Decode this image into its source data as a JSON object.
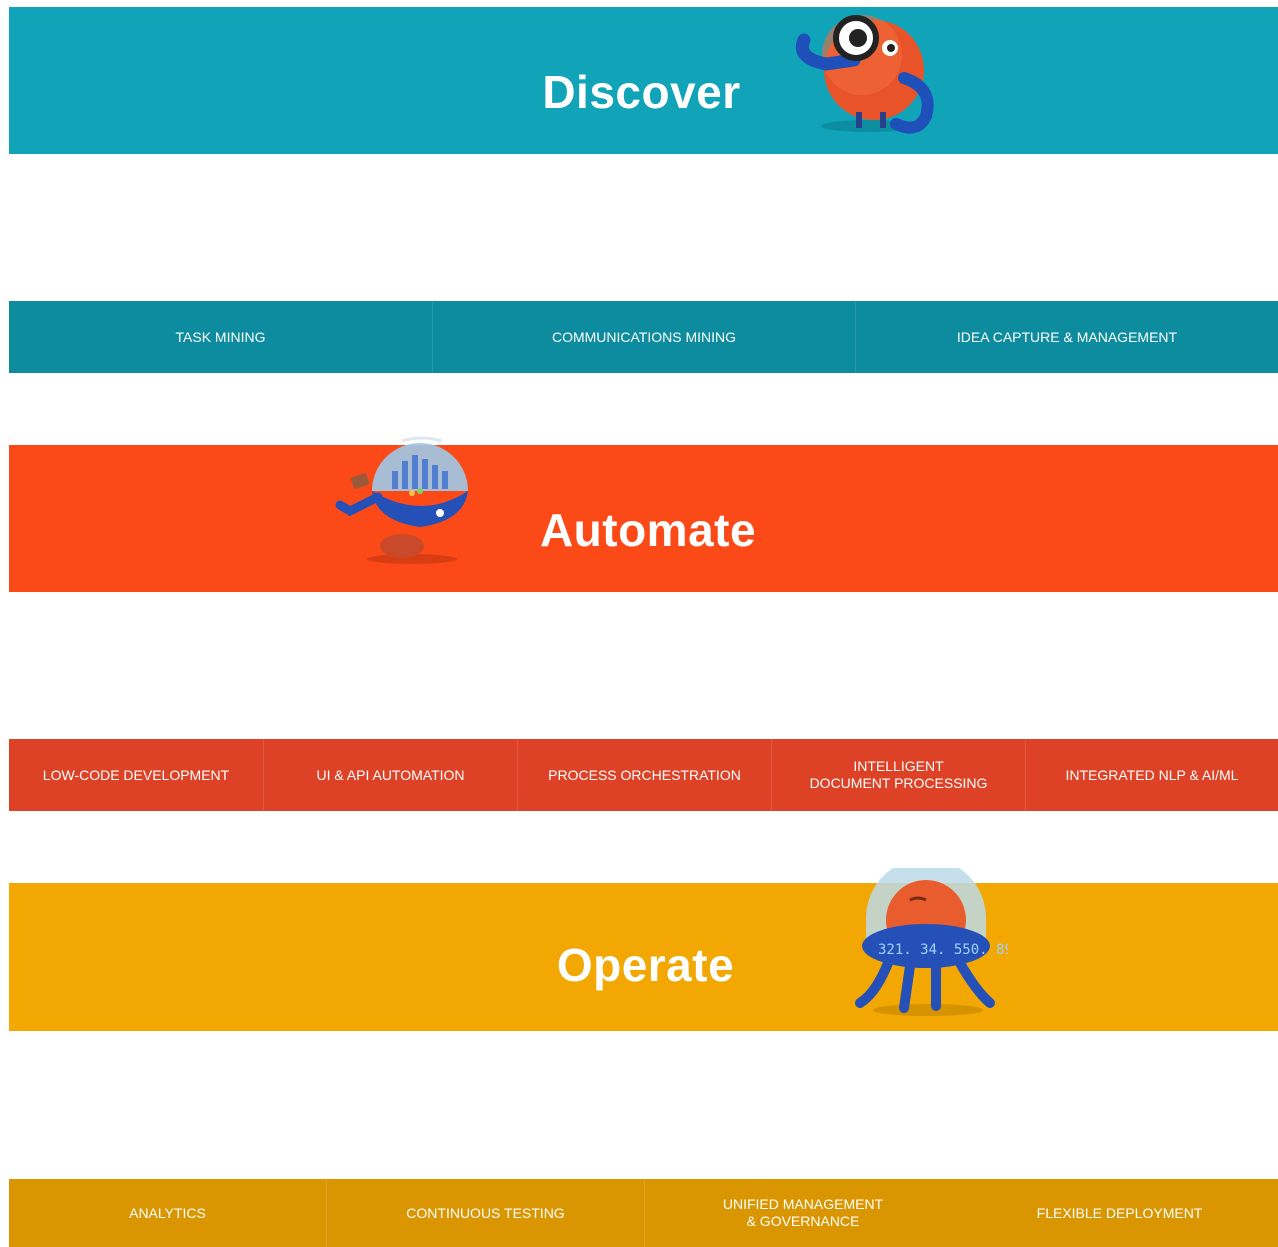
{
  "sections": [
    {
      "title": "Discover",
      "color": "#11a4b8",
      "sub_color": "#0c8c9e",
      "items": [
        "TASK MINING",
        "COMMUNICATIONS MINING",
        "IDEA CAPTURE & MANAGEMENT"
      ]
    },
    {
      "title": "Automate",
      "color": "#fb4a17",
      "sub_color": "#dd4227",
      "items": [
        "LOW-CODE DEVELOPMENT",
        "UI & API AUTOMATION",
        "PROCESS ORCHESTRATION",
        "INTELLIGENT\nDOCUMENT PROCESSING",
        "INTEGRATED NLP & AI/ML"
      ]
    },
    {
      "title": "Operate",
      "color": "#f2a702",
      "sub_color": "#d99600",
      "items": [
        "ANALYTICS",
        "CONTINUOUS TESTING",
        "UNIFIED MANAGEMENT\n& GOVERNANCE",
        "FLEXIBLE DEPLOYMENT"
      ]
    }
  ],
  "mascots": [
    "magnifier-robot-icon",
    "dome-robot-icon",
    "ticker-robot-icon"
  ]
}
